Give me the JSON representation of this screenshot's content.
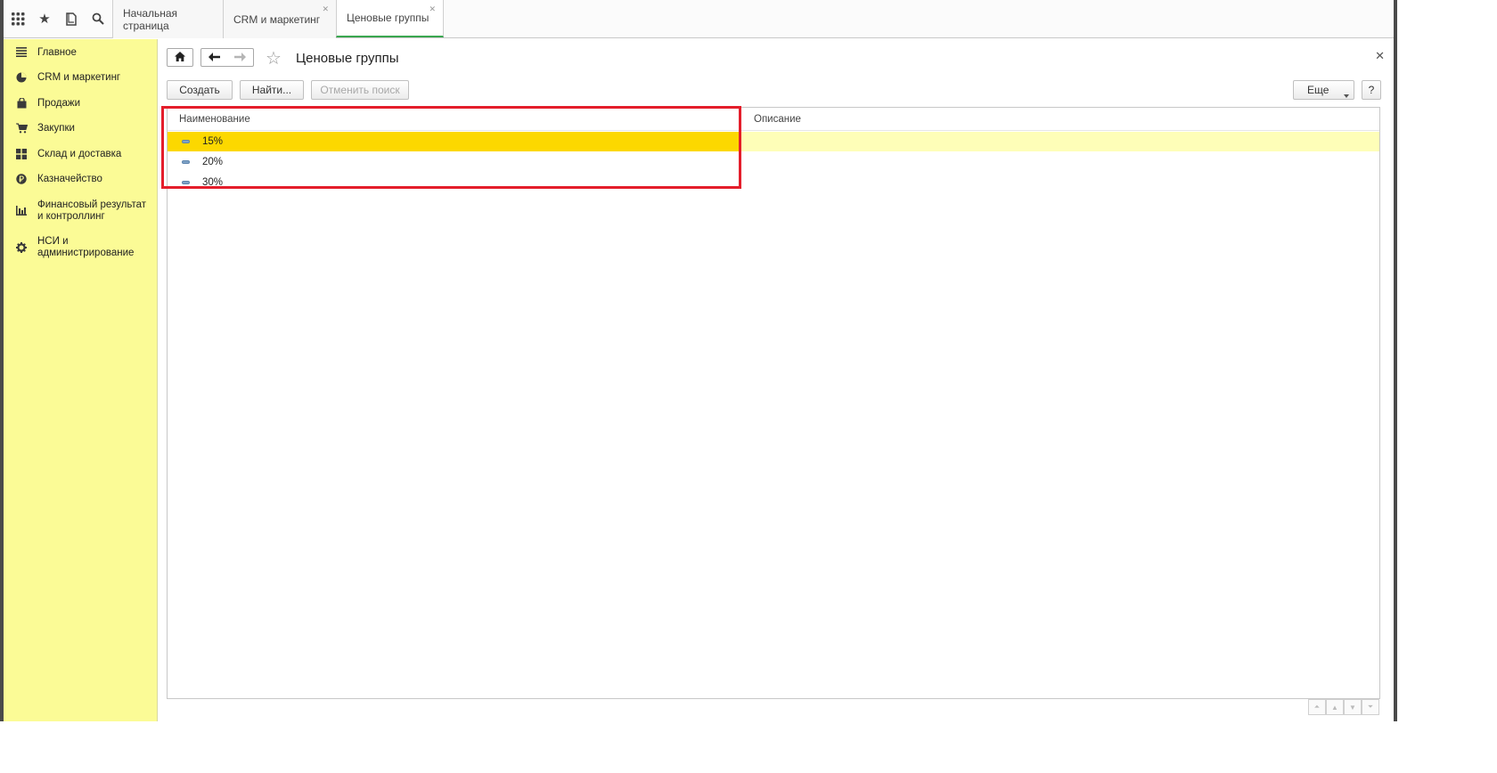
{
  "topbar": {
    "icons": [
      "apps-grid-icon",
      "star-icon",
      "history-icon",
      "search-icon"
    ],
    "tabs": [
      {
        "label": "Начальная страница",
        "closable": false,
        "active": false
      },
      {
        "label": "CRM и маркетинг",
        "closable": true,
        "active": false
      },
      {
        "label": "Ценовые группы",
        "closable": true,
        "active": true
      }
    ],
    "active_tab_color": "#3aa64f"
  },
  "sidebar": {
    "background": "#fbfb96",
    "items": [
      {
        "label": "Главное",
        "icon": "menu-lines-icon"
      },
      {
        "label": "CRM и маркетинг",
        "icon": "pie-chart-icon"
      },
      {
        "label": "Продажи",
        "icon": "shopping-bag-icon"
      },
      {
        "label": "Закупки",
        "icon": "cart-icon"
      },
      {
        "label": "Склад и доставка",
        "icon": "warehouse-grid-icon"
      },
      {
        "label": "Казначейство",
        "icon": "ruble-coin-icon"
      },
      {
        "label": "Финансовый результат и контроллинг",
        "icon": "bar-chart-icon"
      },
      {
        "label": "НСИ и администрирование",
        "icon": "gear-icon"
      }
    ]
  },
  "form": {
    "title": "Ценовые группы",
    "toolbar": {
      "create": "Создать",
      "find": "Найти...",
      "cancel_search": "Отменить поиск",
      "more": "Еще",
      "help": "?"
    },
    "table": {
      "columns": [
        "Наименование",
        "Описание"
      ],
      "rows": [
        {
          "name": "15%",
          "description": "",
          "selected": true
        },
        {
          "name": "20%",
          "description": "",
          "selected": false
        },
        {
          "name": "30%",
          "description": "",
          "selected": false
        }
      ]
    },
    "selected_row_color": "#fcd800",
    "highlight_color": "#e41e2b"
  }
}
